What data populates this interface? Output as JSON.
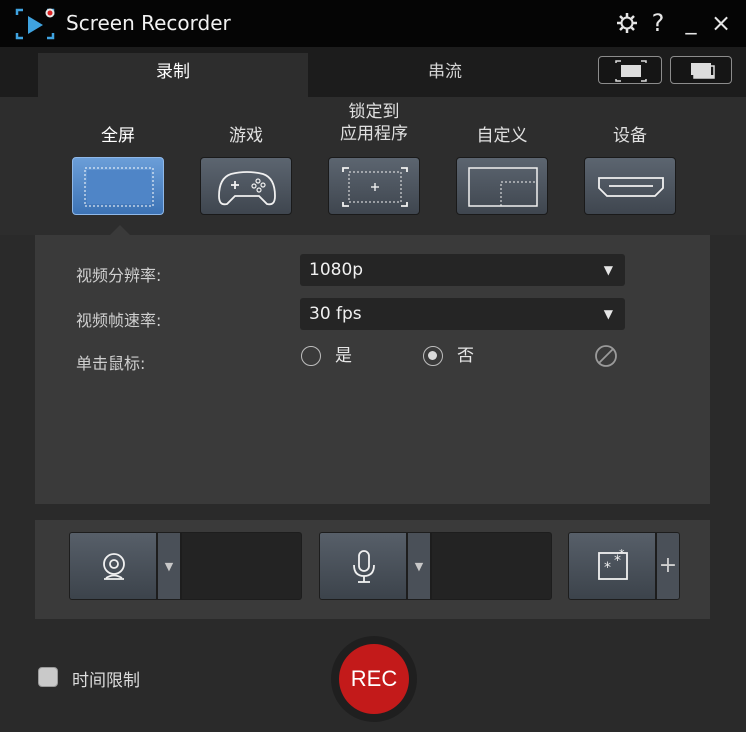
{
  "app": {
    "title": "Screen Recorder"
  },
  "window_controls": {
    "settings_icon": "gear-icon",
    "help": "?",
    "minimize": "_",
    "close": "×"
  },
  "tabs": [
    {
      "label": "录制",
      "active": true
    },
    {
      "label": "串流",
      "active": false
    }
  ],
  "modes": [
    {
      "label": "全屏",
      "icon": "fullscreen-icon",
      "active": true
    },
    {
      "label": "游戏",
      "icon": "gamepad-icon",
      "active": false
    },
    {
      "label": "锁定到\n应用程序",
      "icon": "lock-to-app-icon",
      "active": false
    },
    {
      "label": "自定义",
      "icon": "custom-area-icon",
      "active": false
    },
    {
      "label": "设备",
      "icon": "hdmi-device-icon",
      "active": false
    }
  ],
  "settings": {
    "resolution_label": "视频分辨率:",
    "resolution_value": "1080p",
    "framerate_label": "视频帧速率:",
    "framerate_value": "30 fps",
    "click_label": "单击鼠标:",
    "click_yes": "是",
    "click_no": "否",
    "selected": "否"
  },
  "sources": {
    "webcam_icon": "webcam-icon",
    "mic_icon": "microphone-icon",
    "effect_icon": "effects-icon",
    "add": "+"
  },
  "bottom": {
    "time_limit_label": "时间限制",
    "time_limit_checked": false,
    "rec_label": "REC"
  },
  "colors": {
    "accent": "#4a82c4",
    "rec": "#c31a1a",
    "background": "#2a2a2a"
  }
}
